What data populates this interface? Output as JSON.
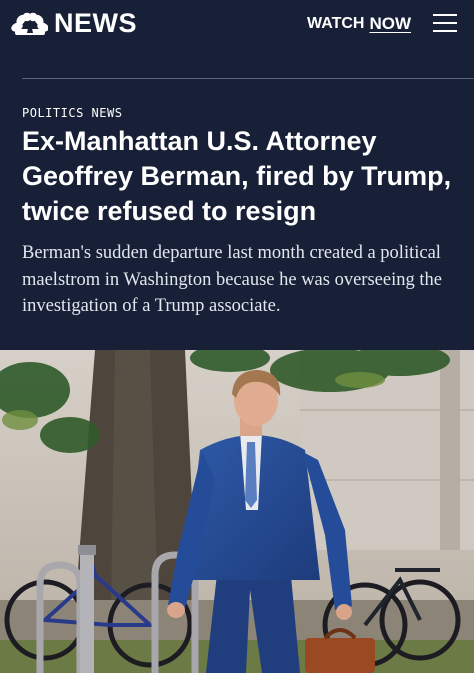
{
  "header": {
    "brand": "NEWS",
    "logo_icon": "peacock-logo-icon",
    "watch_label": "WATCH",
    "watch_now": "NOW",
    "menu_icon": "hamburger-menu-icon"
  },
  "article": {
    "section": "POLITICS NEWS",
    "headline": "Ex-Manhattan U.S. Attorney Geoffrey Berman, fired by Trump, twice refused to resign",
    "dek": "Berman's sudden departure last month created a political maelstrom in Washington because he was overseeing the investigation of a Trump associate."
  },
  "colors": {
    "header_bg": "#172036",
    "text": "#ffffff",
    "peacock": [
      "#ffffff"
    ]
  }
}
